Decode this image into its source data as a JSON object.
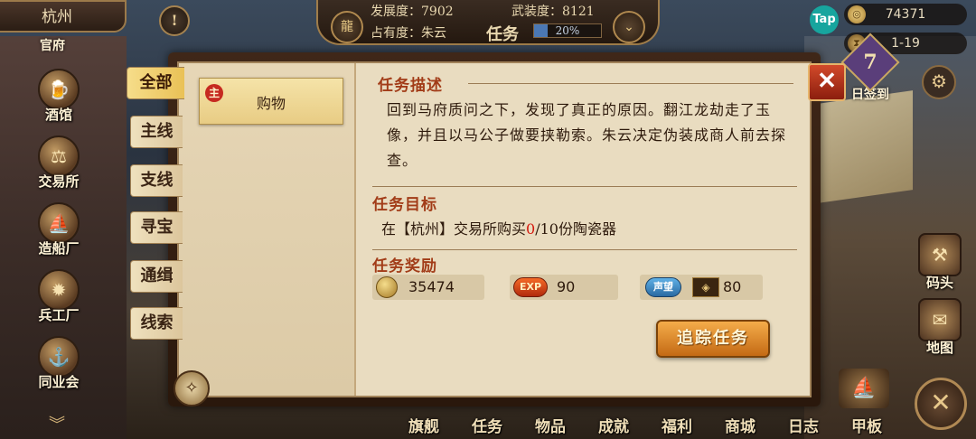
{
  "top": {
    "city": "杭州",
    "partial_label": "官府",
    "alert": "!",
    "development_label": "发展度：7902",
    "military_label": "武装度：8121",
    "occupancy_label": "占有度：朱云",
    "task_label": "任务",
    "progress_text": "20%",
    "progress_fraction": 0.2
  },
  "resources": {
    "tap_label": "Tap",
    "coins": "74371",
    "date": "1-19"
  },
  "checkin": {
    "number": "7",
    "label": "日签到"
  },
  "left_buildings": [
    {
      "label": "酒馆",
      "icon": "tavern-icon"
    },
    {
      "label": "交易所",
      "icon": "scales-icon"
    },
    {
      "label": "造船厂",
      "icon": "ship-icon"
    },
    {
      "label": "兵工厂",
      "icon": "cannon-icon"
    },
    {
      "label": "同业会",
      "icon": "anchor-shield-icon"
    }
  ],
  "right_buildings": [
    {
      "label": "码头",
      "icon": "dock-icon"
    },
    {
      "label": "地图",
      "icon": "scroll-map-icon"
    }
  ],
  "bottom_nav": [
    "旗舰",
    "任务",
    "物品",
    "成就",
    "福利",
    "商城",
    "日志",
    "甲板"
  ],
  "tabs": [
    "全部",
    "主线",
    "支线",
    "寻宝",
    "通缉",
    "线索"
  ],
  "task_list": [
    {
      "badge": "主",
      "name": "购物"
    }
  ],
  "detail": {
    "desc_title": "任务描述",
    "description": "回到马府质问之下，发现了真正的原因。翻江龙劫走了玉像，并且以马公子做要挟勒索。朱云决定伪装成商人前去探查。",
    "goal_title": "任务目标",
    "goal_prefix": "在【杭州】交易所购买",
    "goal_current": "0",
    "goal_suffix": "/10份陶瓷器",
    "reward_title": "任务奖励",
    "rewards": {
      "silver": "35474",
      "exp_tag": "EXP",
      "exp": "90",
      "fame_tag": "声望",
      "fame": "80"
    },
    "track_button": "追踪任务"
  },
  "colors": {
    "accent_red": "#a23c18",
    "progress_red": "#d4190e",
    "button_orange": "#e08a2a",
    "parchment": "#e9dcc0"
  }
}
